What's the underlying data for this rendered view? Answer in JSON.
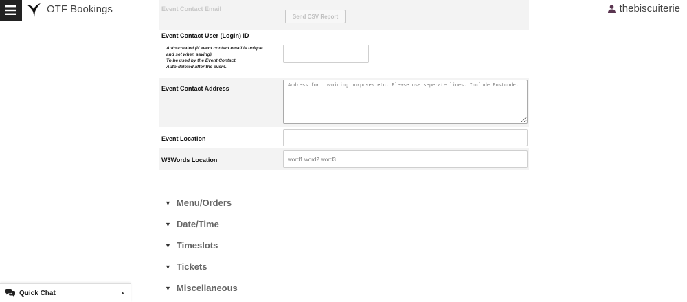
{
  "header": {
    "menu_icon": "hamburger-menu-icon",
    "logo_icon": "bird-logo-icon",
    "app_title": "OTF Bookings",
    "user_icon": "user-icon",
    "username": "thebiscuiterie"
  },
  "form": {
    "contact_email": {
      "label": "Event Contact Email",
      "csv_button": "Send CSV Report"
    },
    "contact_user": {
      "label": "Event Contact User (Login) ID",
      "notes": [
        "Auto-created (if event contact email is unique",
        "and set when saving).",
        "To be used by the Event Contact.",
        "Auto-deleted after the event."
      ],
      "value": ""
    },
    "contact_address": {
      "label": "Event Contact Address",
      "placeholder": "Address for invoicing purposes etc. Please use seperate lines. Include Postcode."
    },
    "location": {
      "label": "Event Location",
      "value": ""
    },
    "w3words": {
      "label": "W3Words Location",
      "placeholder": "word1.word2.word3"
    }
  },
  "sections": [
    {
      "label": "Menu/Orders",
      "icon": "triangle-down-icon"
    },
    {
      "label": "Date/Time",
      "icon": "triangle-down-icon"
    },
    {
      "label": "Timeslots",
      "icon": "triangle-down-icon"
    },
    {
      "label": "Tickets",
      "icon": "triangle-down-icon"
    },
    {
      "label": "Miscellaneous",
      "icon": "triangle-down-icon"
    }
  ],
  "quick_chat": {
    "icon": "chat-bubbles-icon",
    "label": "Quick Chat",
    "toggle_icon": "caret-up-icon"
  }
}
